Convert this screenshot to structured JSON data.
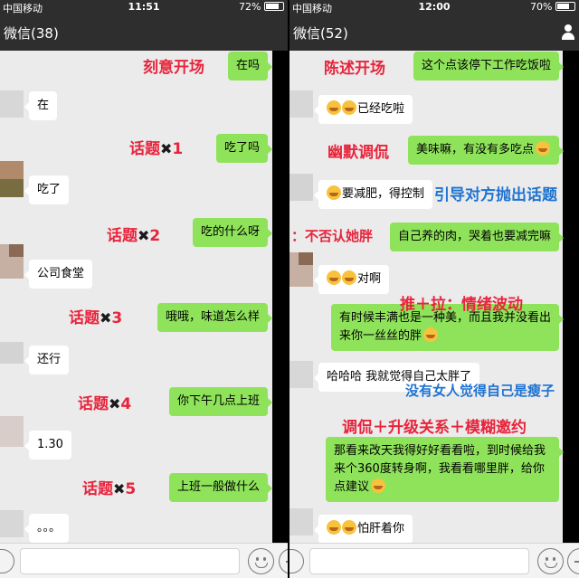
{
  "left": {
    "status": {
      "carrier": "中国移动",
      "time": "11:51",
      "battery": "72%"
    },
    "title": "微信(38)",
    "messages": [
      {
        "text": "在吗"
      },
      {
        "text": "在"
      },
      {
        "text": "吃了吗"
      },
      {
        "text": "吃了"
      },
      {
        "text": "吃的什么呀"
      },
      {
        "text": "公司食堂"
      },
      {
        "text": "哦哦，味道怎么样"
      },
      {
        "text": "还行"
      },
      {
        "text": "你下午几点上班"
      },
      {
        "text": "1.30"
      },
      {
        "text": "上班一般做什么"
      },
      {
        "text": "。。。"
      }
    ],
    "annotations": {
      "opening": "刻意开场",
      "topic1": "话题",
      "num1": "1",
      "topic2": "话题",
      "num2": "2",
      "topic3": "话题",
      "num3": "3",
      "topic4": "话题",
      "num4": "4",
      "topic5": "话题",
      "num5": "5",
      "times": "✖"
    }
  },
  "right": {
    "status": {
      "carrier": "中国移动",
      "time": "12:00",
      "battery": "70%"
    },
    "title": "微信(52)",
    "messages": [
      {
        "text": "这个点该停下工作吃饭啦"
      },
      {
        "text": "已经吃啦"
      },
      {
        "text": "美味嘛，有没有多吃点"
      },
      {
        "text": "要减肥，得控制"
      },
      {
        "text": "自己养的肉，哭着也要减完嘛"
      },
      {
        "text": "对啊"
      },
      {
        "text": "有时候丰满也是一种美，而且我并没看出来你一丝丝的胖"
      },
      {
        "text": "哈哈哈 我就觉得自己太胖了"
      },
      {
        "text": "那看来改天我得好好看看啦，到时候给我来个360度转身啊，我看看哪里胖，给你点建议"
      },
      {
        "text": "怕肝着你"
      }
    ],
    "annotations": {
      "a1": "陈述开场",
      "a2": "幽默调侃",
      "a3": "引导对方抛出话题",
      "a4": "：不否认她胖",
      "a5": "推＋拉：情绪波动",
      "a6": "没有女人觉得自己是瘦子",
      "a7": "调侃＋升级关系＋模糊邀约"
    }
  },
  "colors": {
    "annotation_red": "#e8243c",
    "annotation_blue": "#1e73d2",
    "bubble_green": "#8fe35a"
  }
}
